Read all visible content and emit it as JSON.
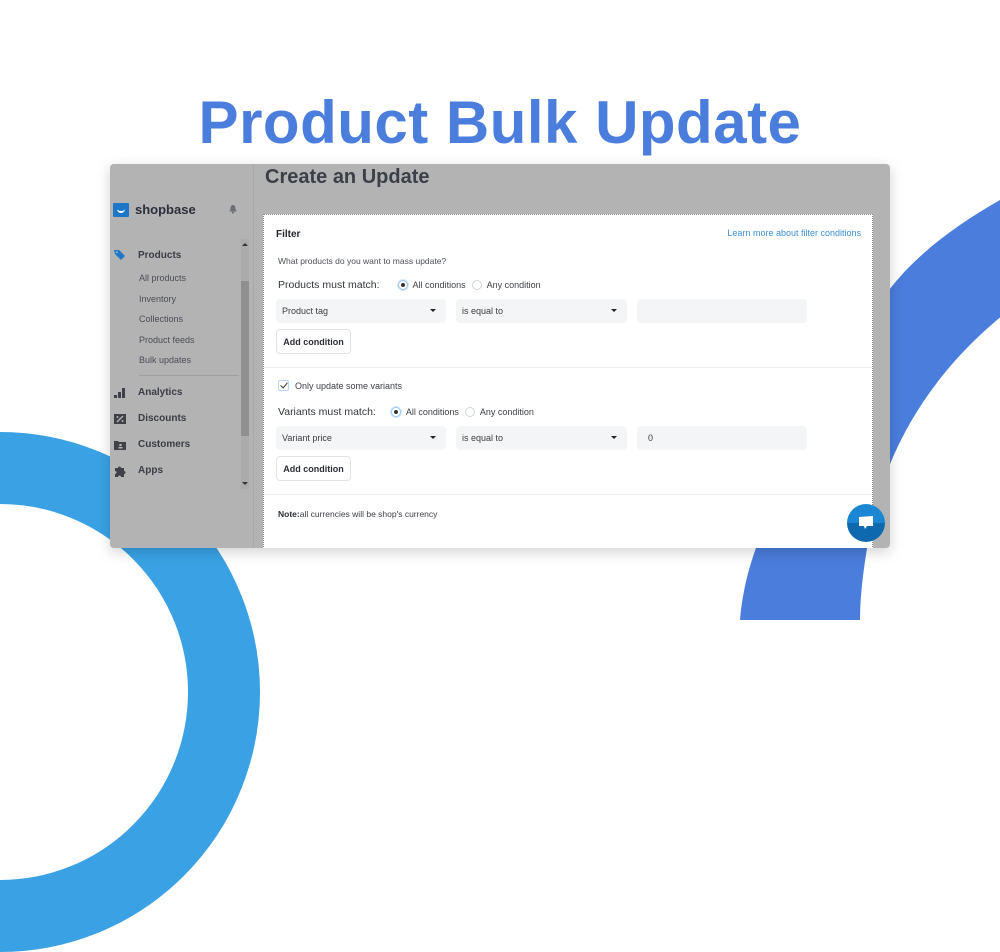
{
  "hero": {
    "title": "Product Bulk Update"
  },
  "colors": {
    "accent": "#4a7ddc",
    "link": "#3b8fd6",
    "brand": "#1d77c9",
    "chat": "#1a86d4"
  },
  "sidebar": {
    "brand": "shopbase",
    "notification_icon": "bell-icon",
    "sections": [
      {
        "label": "Products",
        "icon": "tags-icon"
      },
      {
        "label": "Analytics",
        "icon": "bar-chart-icon"
      },
      {
        "label": "Discounts",
        "icon": "discount-icon"
      },
      {
        "label": "Customers",
        "icon": "customer-folder-icon"
      },
      {
        "label": "Apps",
        "icon": "puzzle-icon"
      }
    ],
    "product_sub_items": [
      "All products",
      "Inventory",
      "Collections",
      "Product feeds",
      "Bulk updates"
    ]
  },
  "main": {
    "title": "Create an Update",
    "filter": {
      "heading": "Filter",
      "learn_more": "Learn more about filter conditions",
      "question": "What products do you want to mass update?",
      "products_match": {
        "label": "Products must match:",
        "options": [
          "All conditions",
          "Any condition"
        ],
        "selected": "All conditions"
      },
      "product_condition": {
        "field": "Product tag",
        "operator": "is equal to",
        "value": ""
      },
      "add_condition": "Add condition",
      "variants_checkbox": {
        "label": "Only update some variants",
        "checked": true
      },
      "variants_match": {
        "label": "Variants must match:",
        "options": [
          "All conditions",
          "Any condition"
        ],
        "selected": "All conditions"
      },
      "variant_condition": {
        "field": "Variant price",
        "operator": "is equal to",
        "value": "0"
      },
      "add_condition_2": "Add condition",
      "note_label": "Note:",
      "note_text": "all currencies will be shop's currency"
    }
  },
  "chat_widget": {
    "icon": "chat-bubble-icon"
  }
}
